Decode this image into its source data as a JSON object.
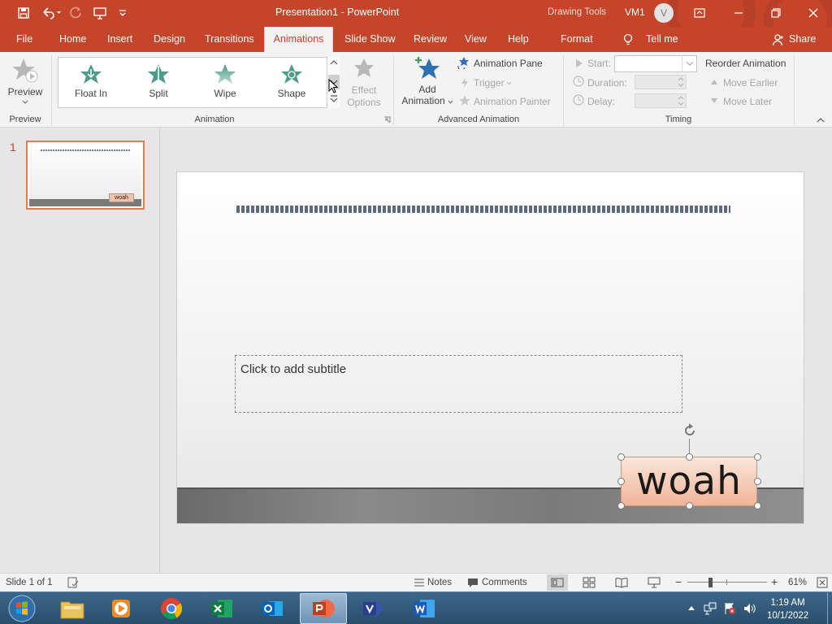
{
  "window": {
    "title": "Presentation1  -  PowerPoint",
    "context_tab_group": "Drawing Tools",
    "user_name": "VM1",
    "user_initial": "V"
  },
  "tabs": [
    {
      "label": "File"
    },
    {
      "label": "Home"
    },
    {
      "label": "Insert"
    },
    {
      "label": "Design"
    },
    {
      "label": "Transitions"
    },
    {
      "label": "Animations",
      "active": true
    },
    {
      "label": "Slide Show"
    },
    {
      "label": "Review"
    },
    {
      "label": "View"
    },
    {
      "label": "Help"
    },
    {
      "label": "Format"
    }
  ],
  "tell_me": "Tell me",
  "share": "Share",
  "ribbon": {
    "preview": {
      "button": "Preview",
      "group": "Preview"
    },
    "animation": {
      "group": "Animation",
      "items": [
        "Float In",
        "Split",
        "Wipe",
        "Shape"
      ],
      "effect_options_1": "Effect",
      "effect_options_2": "Options"
    },
    "advanced": {
      "group": "Advanced Animation",
      "add_animation_1": "Add",
      "add_animation_2": "Animation",
      "animation_pane": "Animation Pane",
      "trigger": "Trigger",
      "animation_painter": "Animation Painter"
    },
    "timing": {
      "group": "Timing",
      "start": "Start:",
      "duration": "Duration:",
      "delay": "Delay:",
      "reorder": "Reorder Animation",
      "move_earlier": "Move Earlier",
      "move_later": "Move Later"
    }
  },
  "thumbnail": {
    "number": "1",
    "text": "woah"
  },
  "slide": {
    "subtitle_placeholder": "Click to add subtitle",
    "textbox": "woah"
  },
  "status": {
    "slide_info": "Slide 1 of 1",
    "notes": "Notes",
    "comments": "Comments",
    "zoom": "61%",
    "zoom_level": 0.61
  },
  "taskbar": {
    "time": "1:19 AM",
    "date": "10/1/2022",
    "apps": [
      "start",
      "file-explorer",
      "media-player",
      "chrome",
      "excel",
      "outlook",
      "powerpoint",
      "visio",
      "word"
    ]
  },
  "colors": {
    "accent": "#c5452b",
    "ribbon_bg": "#f3f3f3",
    "textbox_fill": "#f2c2a8"
  }
}
